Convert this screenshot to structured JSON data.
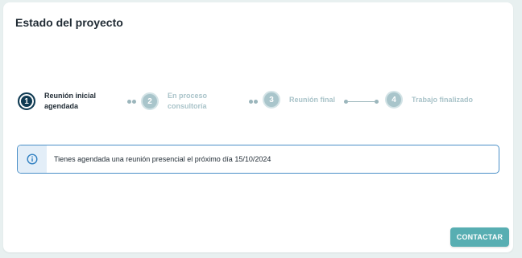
{
  "card": {
    "title": "Estado del proyecto"
  },
  "stepper": {
    "steps": [
      {
        "number": "1",
        "label_line1": "Reunión inicial",
        "label_line2": "agendada",
        "state": "active"
      },
      {
        "number": "2",
        "label_line1": "En proceso",
        "label_line2": "consultoría",
        "state": "inactive"
      },
      {
        "number": "3",
        "label_line1": "Reunión final",
        "label_line2": "",
        "state": "inactive"
      },
      {
        "number": "4",
        "label_line1": "Trabajo finalizado",
        "label_line2": "",
        "state": "inactive"
      }
    ]
  },
  "info_banner": {
    "icon": "info-icon",
    "text": "Tienes agendada una reunión presencial el próximo día 15/10/2024"
  },
  "actions": {
    "contact_label": "CONTACTAR"
  },
  "colors": {
    "active_step": "#0f3a52",
    "inactive_step": "#a9c5cb",
    "info_border": "#4a8fc7",
    "button": "#58aeb2"
  }
}
